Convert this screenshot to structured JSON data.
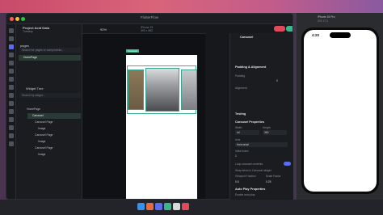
{
  "window": {
    "title": "FlutterFlow",
    "project": "Project Acid Data",
    "project_sub": "Dev mode",
    "branch": "Tuesday",
    "device_label": "iPhone 15",
    "device_size": "393 × 852",
    "zoom": "90%",
    "badge": "Carousel"
  },
  "left_panel": {
    "pages_label": "pages",
    "search_placeholder": "Search for pages or components...",
    "home_page": "HomePage",
    "widget_tree_label": "Widget Tree",
    "search_widget_placeholder": "Search by widget...",
    "tree": [
      "HomePage",
      "Carousel",
      "Carousel Page",
      "Image",
      "Carousel Page",
      "Image",
      "Carousel Page",
      "Image"
    ]
  },
  "right_panel": {
    "component": "Carousel",
    "sections": [
      "Padding & Alignment",
      "Padding",
      "Alignment",
      "Testing",
      "Carousel Properties",
      "Width",
      "Height",
      "Axis",
      "Initial Index",
      "Loop carousel contents",
      "Wrap items in Carousel widget",
      "Viewport Fraction",
      "Scale Factor",
      "Auto Play Properties",
      "Enable auto play"
    ],
    "values": {
      "padding": "0",
      "width": "inf",
      "height": "360",
      "axis": "Horizontal",
      "initial_index": "1",
      "viewport_fraction": "0.8",
      "scale_factor": "0.25"
    },
    "unit_px": "px",
    "unit_pct": "%"
  },
  "simulator": {
    "title": "iPhone 15 Pro",
    "os": "iOS 17.0",
    "time": "4:20"
  },
  "colors": {
    "accent": "#3ab68f",
    "primary": "#5b6cf0",
    "danger": "#e04a5a"
  }
}
